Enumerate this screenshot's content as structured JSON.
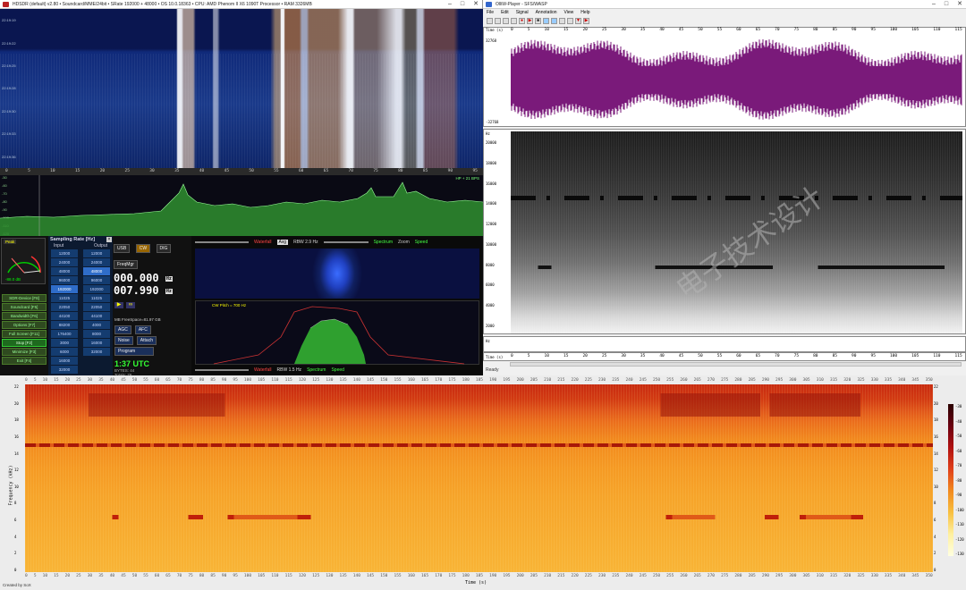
{
  "hdsdr": {
    "title": "HDSDR (default) v2.80 • Soundcard/MME/24bit • SRate 192000 + 48000 • OS 10.0.18363 • CPU: AMD Phenom II X6 1090T Processor • RAM 3326MB",
    "time_labels": [
      "22:19:19",
      "22:19:22",
      "22:19:25",
      "22:19:28",
      "22:19:30",
      "22:19:33",
      "22:19:36"
    ],
    "freq_ticks": [
      "0",
      "5",
      "10",
      "15",
      "20",
      "25",
      "30",
      "35",
      "40",
      "45",
      "50",
      "55",
      "60",
      "65",
      "70",
      "75",
      "80",
      "85",
      "90",
      "95"
    ],
    "spectrum_db": [
      "-50",
      "-60",
      "-70",
      "-80",
      "-90",
      "-100",
      "-110",
      "-120"
    ],
    "spectrum_note": "HP + 21 BPS",
    "peak_label": "Peak",
    "smeter_value": "-88.0 dB",
    "sampling_title": "Sampling Rate [Hz]",
    "input_label": "Input",
    "output_label": "Output",
    "input_rates": [
      "12000",
      "24000",
      "48000",
      "96000",
      "192000",
      "11025",
      "22050",
      "44100",
      "88200",
      "176400",
      "3000",
      "6000",
      "16000",
      "32000"
    ],
    "output_rates": [
      "12000",
      "24000",
      "48000",
      "96000",
      "192000",
      "11025",
      "22050",
      "44100",
      "4000",
      "8000",
      "16000",
      "32000"
    ],
    "selected_input": "192000",
    "selected_output": "48000",
    "left_buttons": [
      {
        "label": "SDR-Device [F8]",
        "style": "normal"
      },
      {
        "label": "Soundcard [F5]",
        "style": "normal"
      },
      {
        "label": "Bandwidth [F6]",
        "style": "normal"
      },
      {
        "label": "Options [F7]",
        "style": "normal"
      },
      {
        "label": "Full Screen [F11]",
        "style": "normal"
      },
      {
        "label": "Stop [F2]",
        "style": "green"
      },
      {
        "label": "Minimize [F3]",
        "style": "normal"
      },
      {
        "label": "Exit [F4]",
        "style": "normal"
      }
    ],
    "mode_buttons": [
      "USB",
      "CW",
      "DIG",
      "FreqMgr"
    ],
    "lo_freq": "000.000",
    "tune_freq": "007.990",
    "lo_unit": "Hz",
    "tune_unit": "Hz",
    "disk_text": "MB  FreeSpace=81.97 GB",
    "clock": "1:37 UTC",
    "stats1": "BYTES: 44",
    "stats2": "Totals: 78",
    "waterfall_label": "Waterfall",
    "spectrum_label": "Spectrum",
    "rbw1": "RBW  2.9 Hz",
    "rbw2": "RBW  1.5 Hz",
    "zoom_label": "Zoom",
    "speed_label": "Speed",
    "avg_label": "Avg",
    "cw_pitch": "CW Pitch = 700 Hz",
    "agc_label": "AGC",
    "noise_label": "Noise",
    "afc_label": "AFC",
    "attach_label": "Attach",
    "program_label": "Program"
  },
  "olli": {
    "title": "OlliW-Player - SFS/WASP",
    "menu": [
      "File",
      "Edit",
      "Signal",
      "Annotation",
      "View",
      "Help"
    ],
    "time_ticks": [
      "0",
      "5",
      "10",
      "15",
      "20",
      "25",
      "30",
      "35",
      "40",
      "45",
      "50",
      "55",
      "60",
      "65",
      "70",
      "75",
      "80",
      "85",
      "90",
      "95",
      "100",
      "105",
      "110",
      "115"
    ],
    "time_label": "Time (s)",
    "amp_top": "32768",
    "amp_bottom": "-32768",
    "freq_label": "Hz",
    "freq_ticks": [
      "20000",
      "18000",
      "16000",
      "14000",
      "12000",
      "10000",
      "8000",
      "6000",
      "4000",
      "2000"
    ],
    "status": "Ready",
    "watermark": "电子技术设计"
  },
  "bottom": {
    "x_ticks": [
      "0",
      "5",
      "10",
      "15",
      "20",
      "25",
      "30",
      "35",
      "40",
      "45",
      "50",
      "55",
      "60",
      "65",
      "70",
      "75",
      "80",
      "85",
      "90",
      "95",
      "100",
      "105",
      "110",
      "115",
      "120",
      "125",
      "130",
      "135",
      "140",
      "145",
      "150",
      "155",
      "160",
      "165",
      "170",
      "175",
      "180",
      "185",
      "190",
      "195",
      "200",
      "205",
      "210",
      "215",
      "220",
      "225",
      "230",
      "235",
      "240",
      "245",
      "250",
      "255",
      "260",
      "265",
      "270",
      "275",
      "280",
      "285",
      "290",
      "295",
      "300",
      "305",
      "310",
      "315",
      "320",
      "325",
      "330",
      "335",
      "340",
      "345",
      "350"
    ],
    "x_label": "Time (s)",
    "y_ticks": [
      "22",
      "20",
      "18",
      "16",
      "14",
      "12",
      "10",
      "8",
      "6",
      "4",
      "2",
      "0"
    ],
    "y_label": "Frequency (kHz)",
    "colorbar": [
      "-30",
      "-40",
      "-50",
      "-60",
      "-70",
      "-80",
      "-90",
      "-100",
      "-110",
      "-120",
      "-130"
    ],
    "status": "Created by SoX"
  },
  "colors": {
    "hdsdr_bg": "#0a0a0a",
    "waterfall_dark": "#0a1a5c",
    "spectrum_green": "#3aa83a",
    "olli_wave": "#7a1a7a",
    "heat_orange": "#f28a1e"
  }
}
